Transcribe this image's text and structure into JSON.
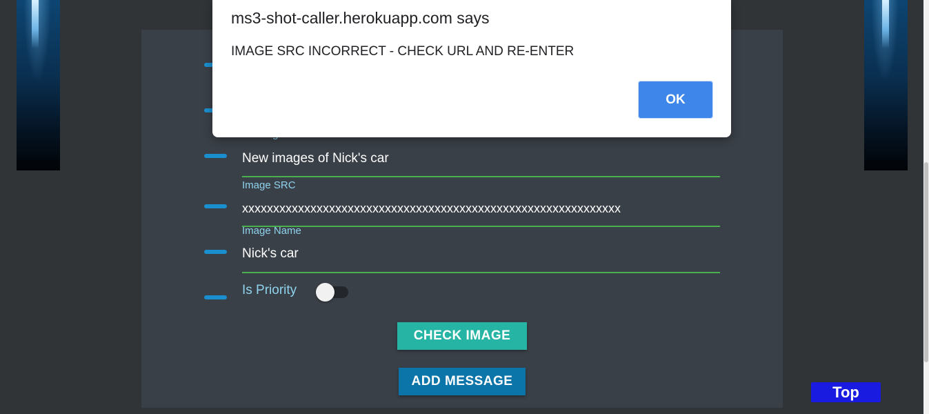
{
  "form": {
    "message_label": "Message",
    "message_value": "New images of Nick's car",
    "image_src_label": "Image SRC",
    "image_src_value": "xxxxxxxxxxxxxxxxxxxxxxxxxxxxxxxxxxxxxxxxxxxxxxxxxxxxxxxxxxxxx",
    "image_name_label": "Image Name",
    "image_name_value": "Nick's car",
    "priority_label": "Is Priority",
    "check_image_label": "CHECK IMAGE",
    "add_message_label": "ADD MESSAGE"
  },
  "top_button": "Top",
  "alert": {
    "title": "ms3-shot-caller.herokuapp.com says",
    "message": "IMAGE SRC INCORRECT - CHECK URL AND RE-ENTER",
    "ok_label": "OK"
  },
  "colors": {
    "accent_blue": "#1a8fcf",
    "input_line": "#4caf50",
    "check_button": "#26b5a4",
    "add_button": "#0b74a8",
    "ok_button": "#3f86eb"
  }
}
